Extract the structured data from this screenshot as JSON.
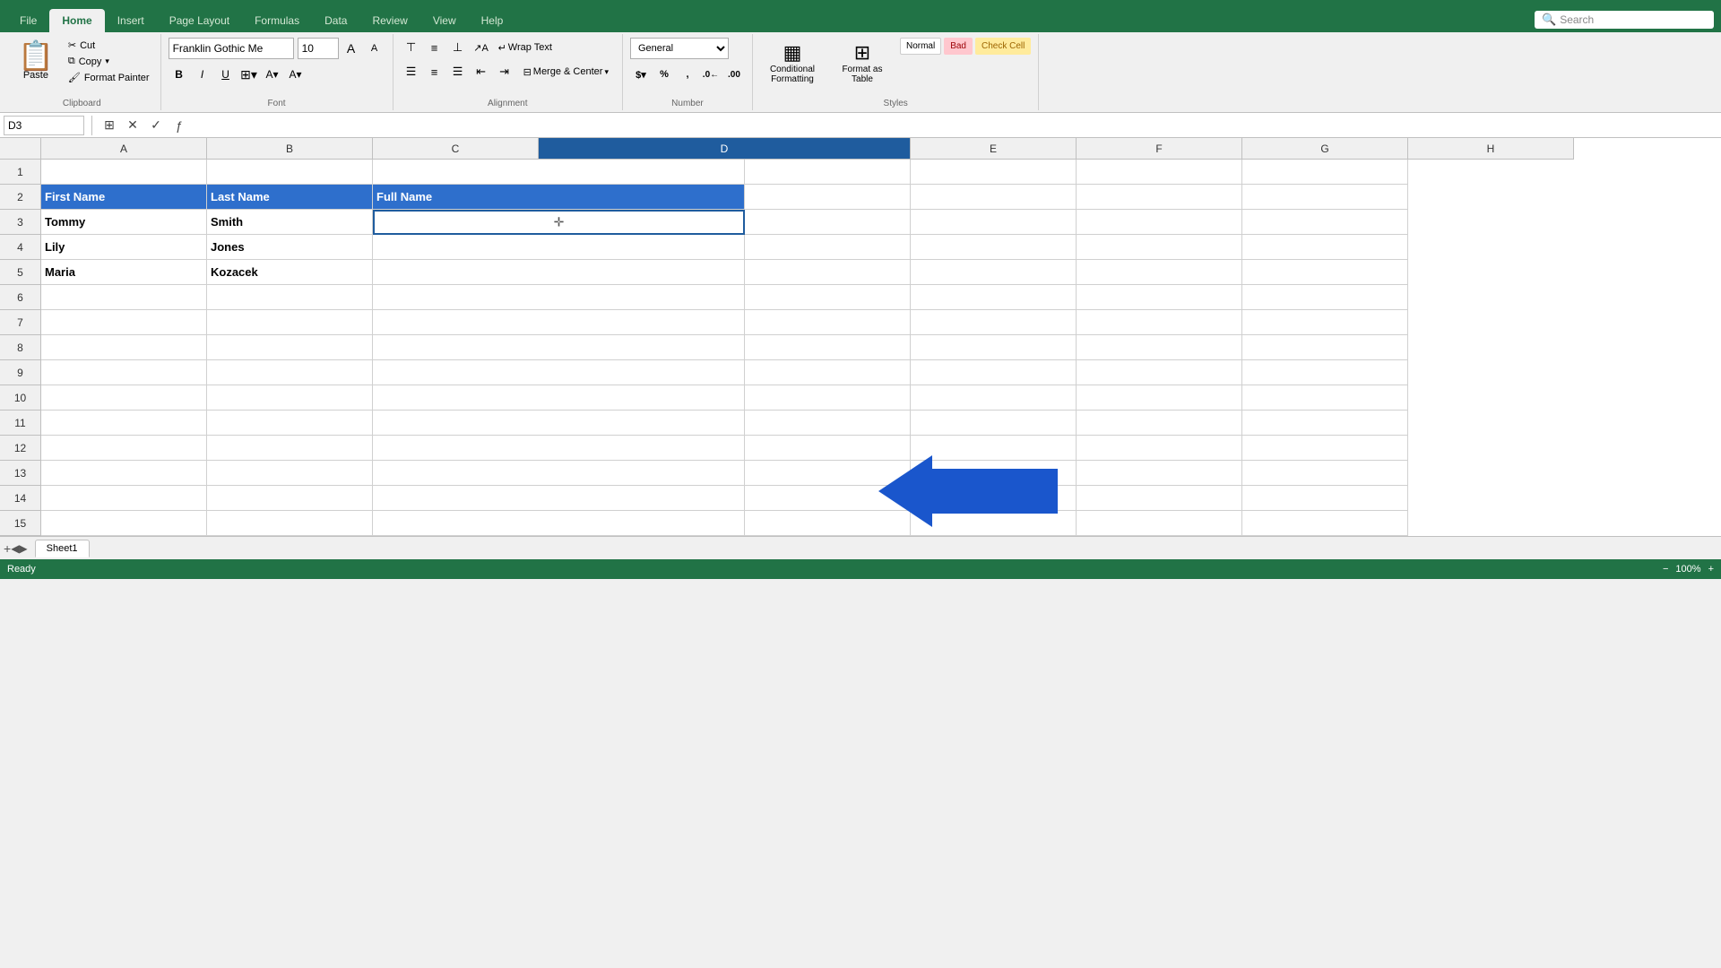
{
  "tabs": [
    {
      "label": "File",
      "active": false
    },
    {
      "label": "Home",
      "active": true
    },
    {
      "label": "Insert",
      "active": false
    },
    {
      "label": "Page Layout",
      "active": false
    },
    {
      "label": "Formulas",
      "active": false
    },
    {
      "label": "Data",
      "active": false
    },
    {
      "label": "Review",
      "active": false
    },
    {
      "label": "View",
      "active": false
    },
    {
      "label": "Help",
      "active": false
    }
  ],
  "ribbon": {
    "clipboard": {
      "label": "Clipboard",
      "paste_label": "Paste",
      "cut_label": "Cut",
      "copy_label": "Copy",
      "format_painter_label": "Format Painter"
    },
    "font": {
      "label": "Font",
      "font_name": "Franklin Gothic Me",
      "font_size": "10",
      "bold": "B",
      "italic": "I",
      "underline": "U"
    },
    "alignment": {
      "label": "Alignment",
      "wrap_text": "Wrap Text",
      "merge_center": "Merge & Center"
    },
    "number": {
      "label": "Number",
      "format": "General"
    },
    "styles": {
      "label": "Styles",
      "conditional_formatting": "Conditional Formatting",
      "format_as_table": "Format as Table",
      "normal": "Normal",
      "bad": "Bad",
      "check_cell": "Check Cell"
    }
  },
  "formula_bar": {
    "cell_ref": "D3",
    "formula": ""
  },
  "search_placeholder": "Search",
  "columns": [
    "A",
    "B",
    "C",
    "D",
    "E",
    "F",
    "G",
    "H"
  ],
  "rows": [
    1,
    2,
    3,
    4,
    5,
    6,
    7,
    8,
    9,
    10,
    11,
    12,
    13,
    14,
    15
  ],
  "data": {
    "b2": "First Name",
    "c2": "Last Name",
    "d2": "Full Name",
    "b3": "Tommy",
    "c3": "Smith",
    "d3": "",
    "b4": "Lily",
    "c4": "Jones",
    "d4": "",
    "b5": "Maria",
    "c5": "Kozacek",
    "d5": ""
  },
  "sheet_tab": "Sheet1",
  "status": "Ready"
}
